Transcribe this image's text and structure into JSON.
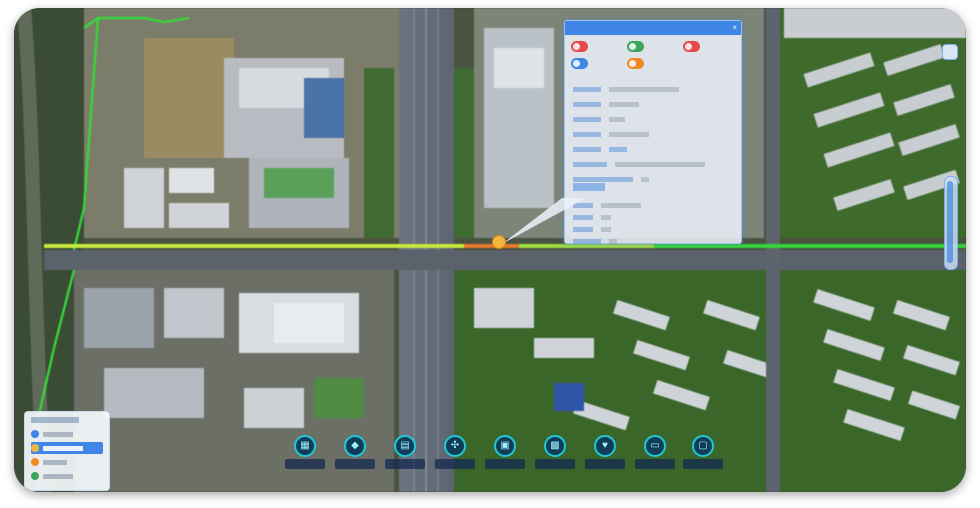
{
  "popup": {
    "title": "",
    "close_icon": "close-icon",
    "tags": [
      {
        "label": "",
        "color": "#e5484d",
        "icon": "circle-icon"
      },
      {
        "label": "",
        "color": "#3ca55c",
        "icon": "circle-icon"
      },
      {
        "label": "",
        "color": "#e5484d",
        "icon": "circle-icon"
      },
      {
        "label": "",
        "color": "#3f86e6",
        "icon": "circle-icon"
      },
      {
        "label": "",
        "color": "#f08a24",
        "icon": "circle-icon"
      }
    ],
    "fields": [
      {
        "key": "",
        "value": ""
      },
      {
        "key": "",
        "value": ""
      },
      {
        "key": "",
        "value": ""
      },
      {
        "key": "",
        "value": ""
      },
      {
        "key": "",
        "value": ""
      },
      {
        "key": "",
        "value": ""
      },
      {
        "key": "",
        "value": ""
      }
    ],
    "section2": [
      {
        "key": "",
        "value": ""
      },
      {
        "key": "",
        "value": ""
      },
      {
        "key": "",
        "value": ""
      },
      {
        "key": "",
        "value": ""
      }
    ]
  },
  "legend": {
    "title": "",
    "items": [
      {
        "label": "",
        "color": "#3f86e6",
        "icon": "pin-icon",
        "active": false
      },
      {
        "label": "",
        "color": "#f2b640",
        "icon": "marker-icon",
        "active": true
      },
      {
        "label": "",
        "color": "#f08a24",
        "icon": "marker-icon",
        "active": false
      },
      {
        "label": "",
        "color": "#3ca55c",
        "icon": "marker-icon",
        "active": false
      }
    ]
  },
  "toolbar": {
    "items": [
      {
        "label": "",
        "icon": "map-icon"
      },
      {
        "label": "",
        "icon": "shield-icon"
      },
      {
        "label": "",
        "icon": "document-icon"
      },
      {
        "label": "",
        "icon": "network-icon"
      },
      {
        "label": "",
        "icon": "report-icon"
      },
      {
        "label": "",
        "icon": "grid-icon"
      },
      {
        "label": "",
        "icon": "heart-icon"
      },
      {
        "label": "",
        "icon": "car-icon"
      },
      {
        "label": "",
        "icon": "monitor-icon"
      }
    ]
  },
  "colors": {
    "pipeline_green": "#35d63a",
    "pipeline_yellow": "#c8e83a",
    "pipeline_orange": "#e8782a",
    "accent_blue": "#3f86e6",
    "toolbar_cyan": "#1fc8d8"
  },
  "map": {
    "scene": "aerial-city-3d",
    "layers": [
      "buildings",
      "roads",
      "pipeline"
    ]
  },
  "controls": {
    "zoom_slider_icon": "zoom-slider-icon",
    "corner_button_icon": "layer-icon"
  }
}
